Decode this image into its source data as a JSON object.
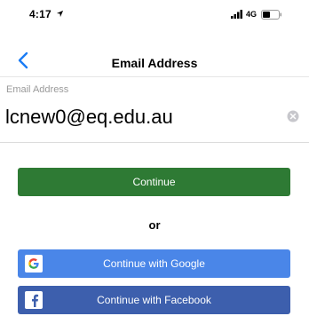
{
  "status_bar": {
    "time": "4:17",
    "network": "4G"
  },
  "nav": {
    "title": "Email Address"
  },
  "form": {
    "label": "Email Address",
    "email_value": "lcnew0@eq.edu.au"
  },
  "actions": {
    "continue_label": "Continue",
    "or_label": "or",
    "google_label": "Continue with Google",
    "facebook_label": "Continue with Facebook"
  },
  "colors": {
    "continue": "#2e7a34",
    "google": "#4a86e8",
    "facebook": "#3d5fad",
    "back_arrow": "#1a7cf5"
  }
}
